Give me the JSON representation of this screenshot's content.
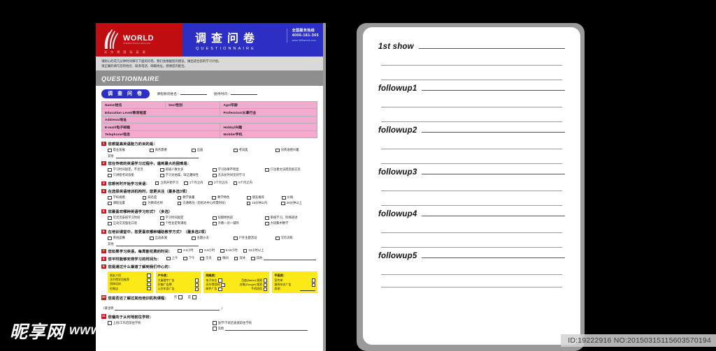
{
  "watermarks": {
    "site_cn": "昵享网",
    "site_url": "www.nipic.cn",
    "id_text": "ID:19222916 NO:20150315115603570194"
  },
  "left_document": {
    "header": {
      "brand_main": "WORLD",
      "brand_sub": "INTERNATIONAL ENGLISH",
      "brand_cn": "沃 尔 得 国 际 英 语",
      "title_cn": "调查问卷",
      "title_en": "QUESTIONNAIRE",
      "hotline_label": "全国服务热线",
      "hotline_number": "4006-181-365",
      "hotline_site": "www.365world.com"
    },
    "intro_line1": "请耐心的花几分钟时间填写下面的问卷。我们会根据您的建议，做出适合您的学习计划。",
    "intro_line2": "请正确的填写您的姓名、联系电话、邮箱地址。感谢您的配合。",
    "section_title": "QUESTIONNAIRE",
    "tag": "调 查 问 卷",
    "meta_consultant": "课程顾问姓名：",
    "meta_time": "接待时间：",
    "profile_table": [
      [
        "Name/姓名",
        "Sex/性别",
        "Age/年龄"
      ],
      [
        "Education Level/教育程度",
        "Profession/从事行业"
      ],
      [
        "Address/地址"
      ],
      [
        "E-mail/电子邮箱",
        "Hobby/兴趣"
      ],
      [
        "Telephone/电话",
        "Mobile/手机"
      ]
    ],
    "questions": [
      {
        "num": "1",
        "text": "您想提高英语能力的目的是：",
        "layout": "grid5",
        "options": [
          "职业发展",
          "商务需要",
          "出国",
          "考试类",
          "对英语感兴趣"
        ],
        "other_label": "其他",
        "other_line": true
      },
      {
        "num": "2",
        "text": "您在传统的英语学习过程中，遇到最大的困难是：",
        "layout": "grid4",
        "options": [
          "学习时间固定，不灵活",
          "班级人数太多",
          "学习效果不明显",
          "只注重文法而忽视交流",
          "只讲程考试技能",
          "学习太枯燥，缺乏趣味性",
          "无法长时间坚持学习"
        ]
      },
      {
        "num": "3",
        "text": "您想何时开始学习英语：",
        "layout": "inline",
        "options": [
          "立刻开始学习",
          "1个月之内",
          "3个月之内",
          "6个月之内"
        ]
      },
      {
        "num": "4",
        "text": "在选择英语培训机构时，您更关注（最多选3项）",
        "layout": "grid6",
        "options": [
          "学校规模",
          "知名度",
          "教学质量",
          "教学特色",
          "朋友推荐",
          "价格",
          "课程设置",
          "外教或名师",
          "交通情况（您抵达中心所需时间）",
          "15分钟以内",
          "20分钟以上"
        ]
      },
      {
        "num": "5",
        "text": "您最喜欢哪种英语学习形式？（多选）",
        "layout": "grid4",
        "options": [
          "可灵活安排学习时间",
          "学习时间固定",
          "短期特色班",
          "系统学习，阶梯递进",
          "互动交流强化口语",
          "个性化定制课程",
          "外教一对一辅导",
          "大班集中教学"
        ]
      },
      {
        "num": "6",
        "text": "在培训课堂中，您更喜欢哪种辅助教学方式？（最多选2项）",
        "layout": "grid5",
        "options": [
          "英语竞赛",
          "互动表演",
          "主题沙龙",
          "户外主题活动",
          "写作训练"
        ],
        "other_label": "其他",
        "other_line": true
      },
      {
        "num": "7",
        "text": "您如果学习英语，每周能花费的时间：",
        "layout": "inline",
        "options": [
          "4-6小时",
          "6-8小时",
          "8-10小时",
          "10小时以上"
        ]
      },
      {
        "num": "8",
        "text": "您平时能够安排学习的时间为：",
        "layout": "inline-other",
        "options": [
          "上午",
          "下午",
          "全天",
          "晚间",
          "双休",
          "其他"
        ]
      },
      {
        "num": "9",
        "text": "您是通过什么渠道了解到我们中心的：",
        "layout": "yellow"
      },
      {
        "num": "10",
        "text": "您是否还了解过其他培训机构课程：",
        "layout": "yesno",
        "options": [
          "否",
          "是"
        ],
        "note": "（请注明",
        "note_end": "）"
      },
      {
        "num": "11",
        "text": "您偏向于从何地前往学校：",
        "layout": "grid-last",
        "options": [
          "上班/工作后前往学校",
          "放学/下班后直接前往学校",
          "其他"
        ]
      }
    ],
    "channel_boxes": [
      {
        "head": "朋友介绍",
        "items": [
          "沃尔得学员推荐",
          "团体培训",
          "形象店"
        ]
      },
      {
        "head": "户外类：",
        "items": [
          "大厦楼宇广告",
          "灯箱广告牌",
          "公交车身广告"
        ]
      },
      {
        "head": "网络类：",
        "items": [
          "电子杂志",
          "百度(Baidu) 搜索",
          "沃尔得官网",
          "谷歌(Google) 搜索",
          "邮件广告",
          "手机短信"
        ]
      },
      {
        "head": "平面类：",
        "items": [
          "宣传单",
          "报纸杂志广告",
          "其他："
        ]
      }
    ]
  },
  "right_page": {
    "sections": [
      {
        "label": "1st show"
      },
      {
        "label": "followup1"
      },
      {
        "label": "followup2"
      },
      {
        "label": "followup3"
      },
      {
        "label": "followup4"
      },
      {
        "label": "followup5"
      }
    ]
  }
}
